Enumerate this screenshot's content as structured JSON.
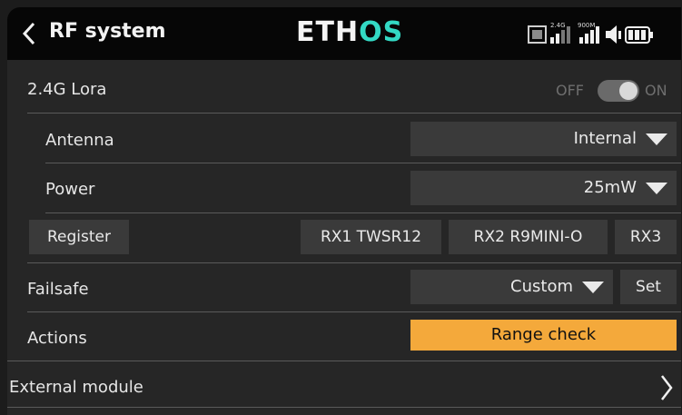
{
  "header": {
    "title": "RF system",
    "logo_main": "ETH",
    "logo_accent": "OS",
    "status_labels": {
      "band1": "2.4G",
      "band2": "900M"
    }
  },
  "internal": {
    "label": "2.4G Lora",
    "toggle": {
      "off_label": "OFF",
      "on_label": "ON",
      "state": "on"
    },
    "antenna": {
      "label": "Antenna",
      "value": "Internal"
    },
    "power": {
      "label": "Power",
      "value": "25mW"
    },
    "register": {
      "label": "Register",
      "receivers": [
        "RX1 TWSR12",
        "RX2 R9MINI-O",
        "RX3"
      ]
    }
  },
  "failsafe": {
    "label": "Failsafe",
    "value": "Custom",
    "set_label": "Set"
  },
  "actions": {
    "label": "Actions",
    "button": "Range check"
  },
  "external": {
    "label": "External module"
  },
  "colors": {
    "accent": "#f4a93b",
    "logo_accent": "#33d9c4",
    "background": "#262626",
    "header": "#060606"
  }
}
